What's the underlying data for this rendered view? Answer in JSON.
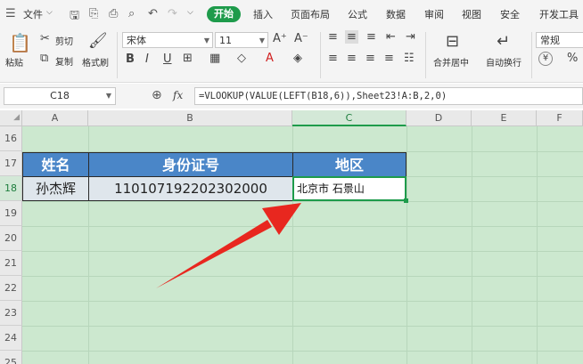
{
  "menubar": {
    "file_label": "文件",
    "tabs": [
      "开始",
      "插入",
      "页面布局",
      "公式",
      "数据",
      "审阅",
      "视图",
      "安全",
      "开发工具"
    ],
    "active_tab": "开始"
  },
  "ribbon": {
    "paste_label": "粘贴",
    "cut_label": "剪切",
    "copy_label": "复制",
    "format_painter_label": "格式刷",
    "font_name": "宋体",
    "font_size": "11",
    "merge_label": "合并居中",
    "wrap_label": "自动换行",
    "number_format": "常规",
    "currency_symbol": "¥",
    "percent_symbol": "%"
  },
  "formula_bar": {
    "cell_ref": "C18",
    "fx_label": "fx",
    "formula": "=VLOOKUP(VALUE(LEFT(B18,6)),Sheet23!A:B,2,0)"
  },
  "sheet": {
    "columns": [
      "A",
      "B",
      "C",
      "D",
      "E",
      "F"
    ],
    "selected_column": "C",
    "rows": [
      "16",
      "17",
      "18",
      "19",
      "20",
      "21",
      "22",
      "23",
      "24",
      "25"
    ],
    "selected_row": "18",
    "table_headers": [
      "姓名",
      "身份证号",
      "地区"
    ],
    "table_row": [
      "孙杰辉",
      "110107192202302000",
      "北京市 石景山"
    ],
    "header_color": "#4a86c8",
    "background_color": "#cce8cf",
    "arrow_color": "#e8271f"
  }
}
